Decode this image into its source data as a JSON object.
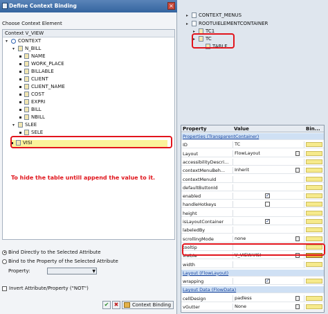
{
  "dialog": {
    "title": "Define Context Binding",
    "choose_label": "Choose Context Element",
    "tree_header": "Context V_VIEW",
    "tree": [
      {
        "label": "CONTEXT",
        "indent": 0,
        "kind": "context"
      },
      {
        "label": "N_BILL",
        "indent": 1,
        "kind": "node"
      },
      {
        "label": "NAME",
        "indent": 2,
        "kind": "attr"
      },
      {
        "label": "WORK_PLACE",
        "indent": 2,
        "kind": "attr"
      },
      {
        "label": "BILLABLE",
        "indent": 2,
        "kind": "attr"
      },
      {
        "label": "CLIENT",
        "indent": 2,
        "kind": "attr"
      },
      {
        "label": "CLIENT_NAME",
        "indent": 2,
        "kind": "attr"
      },
      {
        "label": "COST",
        "indent": 2,
        "kind": "attr"
      },
      {
        "label": "EXPRI",
        "indent": 2,
        "kind": "attr"
      },
      {
        "label": "BILL",
        "indent": 2,
        "kind": "attr"
      },
      {
        "label": "NBILL",
        "indent": 2,
        "kind": "attr"
      },
      {
        "label": "SLEE",
        "indent": 1,
        "kind": "node"
      },
      {
        "label": "SELE",
        "indent": 2,
        "kind": "attr"
      },
      {
        "label": "VISI",
        "indent": 1,
        "kind": "attr",
        "selected": true
      }
    ],
    "hint_text": "To hide the table untill append the value to it.",
    "radio_direct": "Bind Directly to the Selected Attribute",
    "radio_property": "Bind to the Property of the Selected Attribute",
    "property_label": "Property:",
    "invert_label": "Invert Attribute/Property (\"NOT\")",
    "context_binding_button": "Context Binding",
    "accent_red": "#e2141c"
  },
  "element_tree": [
    {
      "label": "CONTEXT_MENUS",
      "indent": 0
    },
    {
      "label": "ROOTUIELEMENTCONTAINER",
      "indent": 0
    },
    {
      "label": "TC1",
      "indent": 1
    },
    {
      "label": "TC",
      "indent": 1
    },
    {
      "label": "TABLE",
      "indent": 2
    }
  ],
  "properties": {
    "columns": [
      "Property",
      "Value",
      "Bin..."
    ],
    "rows": [
      {
        "type": "section",
        "name": "Properties (TransparentContainer)"
      },
      {
        "name": "ID",
        "value": "TC"
      },
      {
        "name": "Layout",
        "value": "FlowLayout",
        "select": true
      },
      {
        "name": "accessibilityDescri...",
        "value": ""
      },
      {
        "name": "contextMenuBeh...",
        "value": "Inherit",
        "select": true
      },
      {
        "name": "contextMenuId",
        "value": ""
      },
      {
        "name": "defaultButtonId",
        "value": ""
      },
      {
        "name": "enabled",
        "value": "",
        "checkbox": true,
        "checked": true
      },
      {
        "name": "handleHotkeys",
        "value": "",
        "checkbox": true,
        "checked": false
      },
      {
        "name": "height",
        "value": ""
      },
      {
        "name": "isLayoutContainer",
        "value": "",
        "checkbox": true,
        "checked": true
      },
      {
        "name": "labeledBy",
        "value": ""
      },
      {
        "name": "scrollingMode",
        "value": "none",
        "select": true
      },
      {
        "name": "tooltip",
        "value": ""
      },
      {
        "name": "visible",
        "value": "V_VIEW.VISI",
        "select": true,
        "bound": true
      },
      {
        "name": "width",
        "value": ""
      },
      {
        "type": "section",
        "name": "Layout (FlowLayout)"
      },
      {
        "name": "wrapping",
        "value": "",
        "checkbox": true,
        "checked": true
      },
      {
        "type": "section",
        "name": "Layout Data (FlowData)"
      },
      {
        "name": "cellDesign",
        "value": "padless",
        "select": true
      },
      {
        "name": "vGutter",
        "value": "None",
        "select": true
      }
    ]
  }
}
